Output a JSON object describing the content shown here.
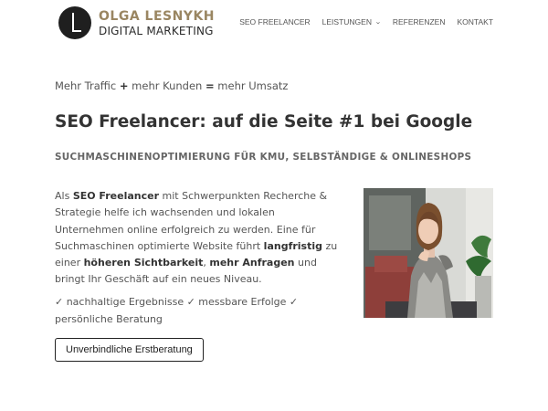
{
  "brand": {
    "name": "OLGA LESNYKH",
    "subtitle": "DIGITAL MARKETING"
  },
  "nav": {
    "items": [
      {
        "label": "SEO FREELANCER"
      },
      {
        "label": "LEISTUNGEN",
        "has_dropdown": true
      },
      {
        "label": "REFERENZEN"
      },
      {
        "label": "KONTAKT"
      }
    ]
  },
  "hero": {
    "tagline": {
      "part1": "Mehr Traffic ",
      "plus": "+",
      "part2": " mehr Kunden ",
      "equals": "=",
      "part3": " mehr Umsatz"
    },
    "title": "SEO Freelancer: auf die Seite #1 bei Google",
    "subtitle": "SUCHMASCHINENOPTIMIERUNG FÜR KMU, SELBSTÄNDIGE & ONLINESHOPS",
    "intro": {
      "t1": "Als ",
      "b1": "SEO Freelancer",
      "t2": " mit Schwerpunkten Recherche & Strategie helfe ich wachsenden und lokalen Unternehmen online erfolgreich zu werden. Eine für Suchmaschinen optimierte Website führt ",
      "b2": "langfristig",
      "t3": " zu einer ",
      "b3": "höheren Sichtbarkeit",
      "t4": ", ",
      "b4": "mehr Anfragen",
      "t5": " und bringt Ihr Geschäft auf ein neues Niveau."
    },
    "checks": "✓ nachhaltige Ergebnisse ✓ messbare Erfolge ✓ persönliche Beratung",
    "cta_label": "Unverbindliche Erstberatung"
  },
  "colors": {
    "brand_gold": "#9a8662",
    "text": "#555555",
    "heading": "#333333"
  }
}
